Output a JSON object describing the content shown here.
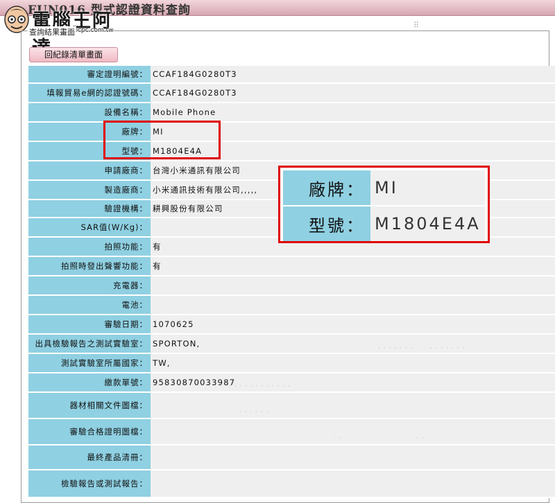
{
  "window": {
    "title": "FUN016 型式認證資料查詢"
  },
  "logo": {
    "brand": "電腦王阿達",
    "url": "http://www.kocpc.com.tw"
  },
  "panel": {
    "legend": "查詢結果畫面",
    "back_button": "回紀錄清單畫面"
  },
  "rows": [
    {
      "label": "審定證明編號：",
      "value": "CCAF184G0280T3"
    },
    {
      "label": "填報貿易e網的認證號碼：",
      "value": "CCAF184G0280T3"
    },
    {
      "label": "設備名稱：",
      "value": "Mobile Phone"
    },
    {
      "label": "廠牌：",
      "value": "MI"
    },
    {
      "label": "型號：",
      "value": "M1804E4A"
    },
    {
      "label": "申請廠商：",
      "value": "台灣小米通訊有限公司"
    },
    {
      "label": "製造廠商：",
      "value": "小米通訊技術有限公司,,,,,"
    },
    {
      "label": "驗證機構：",
      "value": "耕興股份有限公司"
    },
    {
      "label": "SAR值(W/Kg)：",
      "value": ""
    },
    {
      "label": "拍照功能：",
      "value": "有"
    },
    {
      "label": "拍照時發出聲響功能：",
      "value": "有"
    },
    {
      "label": "充電器：",
      "value": ""
    },
    {
      "label": "電池：",
      "value": ""
    },
    {
      "label": "審驗日期：",
      "value": "1070625"
    },
    {
      "label": "出具檢驗報告之測試實驗室：",
      "value": "SPORTON,"
    },
    {
      "label": "測試實驗室所屬國家：",
      "value": "TW,"
    },
    {
      "label": "繳款單號：",
      "value": "95830870033987"
    },
    {
      "label": "器材相關文件圖檔：",
      "value": ""
    },
    {
      "label": "審驗合格證明圖檔：",
      "value": ""
    },
    {
      "label": "最終產品清冊：",
      "value": ""
    },
    {
      "label": "檢驗報告或測試報告：",
      "value": ""
    }
  ],
  "zoom": {
    "brand_label": "廠牌：",
    "brand_value": "MI",
    "model_label": "型號：",
    "model_value": "M1804E4A"
  },
  "colors": {
    "label_bg": "#8fd0e2",
    "value_bg": "#efefef",
    "highlight": "#e00000",
    "title_bar": "#d7a7b1"
  }
}
